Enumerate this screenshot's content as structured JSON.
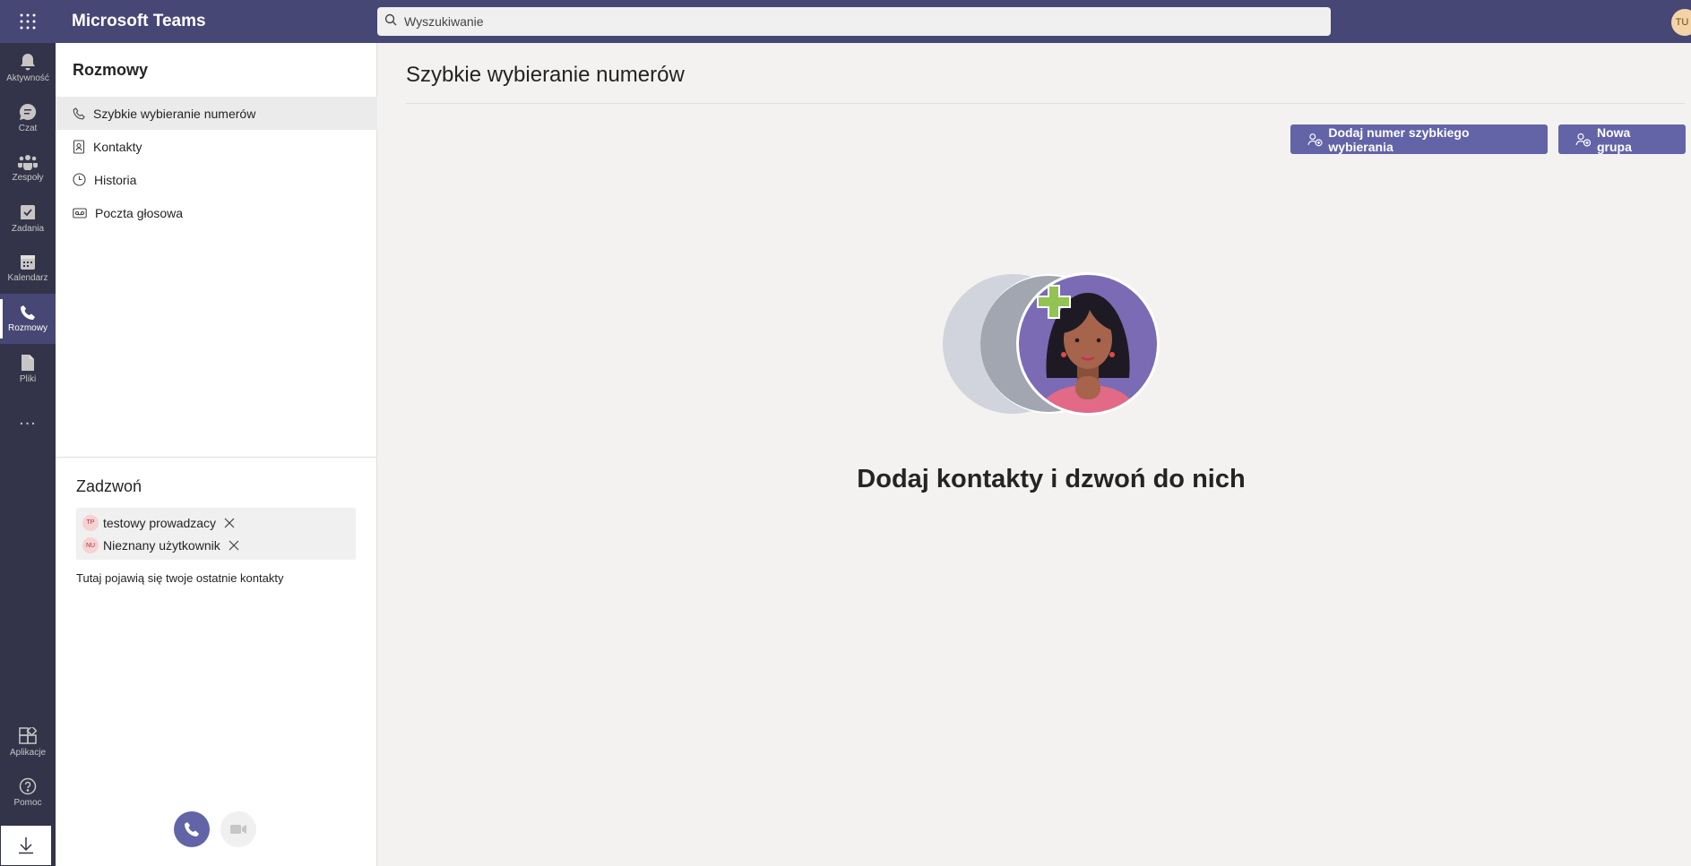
{
  "app": {
    "title": "Microsoft Teams",
    "user_initials": "TU"
  },
  "search": {
    "placeholder": "Wyszukiwanie"
  },
  "rail": {
    "items": [
      {
        "label": "Aktywność",
        "icon": "bell-icon"
      },
      {
        "label": "Czat",
        "icon": "chat-icon"
      },
      {
        "label": "Zespoły",
        "icon": "teams-icon"
      },
      {
        "label": "Zadania",
        "icon": "tasks-icon"
      },
      {
        "label": "Kalendarz",
        "icon": "calendar-icon"
      },
      {
        "label": "Rozmowy",
        "icon": "phone-icon",
        "active": true
      },
      {
        "label": "Pliki",
        "icon": "file-icon"
      },
      {
        "label": "...",
        "icon": "more-icon"
      }
    ],
    "bottom": [
      {
        "label": "Aplikacje",
        "icon": "apps-icon"
      },
      {
        "label": "Pomoc",
        "icon": "help-icon"
      }
    ]
  },
  "leftpane": {
    "title": "Rozmowy",
    "nav": [
      {
        "label": "Szybkie wybieranie numerów",
        "icon": "phone-icon",
        "active": true
      },
      {
        "label": "Kontakty",
        "icon": "contacts-icon"
      },
      {
        "label": "Historia",
        "icon": "clock-icon"
      },
      {
        "label": "Poczta głosowa",
        "icon": "voicemail-icon"
      }
    ],
    "call": {
      "title": "Zadzwoń",
      "chips": [
        {
          "initials": "TP",
          "name": "testowy prowadzacy"
        },
        {
          "initials": "NU",
          "name": "Nieznany użytkownik"
        }
      ],
      "recent_hint": "Tutaj pojawią się twoje ostatnie kontakty"
    }
  },
  "main": {
    "title": "Szybkie wybieranie numerów",
    "add_button": "Dodaj numer szybkiego wybierania",
    "group_button": "Nowa grupa",
    "empty_title": "Dodaj kontakty i dzwoń do nich"
  },
  "colors": {
    "brand": "#464775",
    "accent": "#6264a7",
    "rail": "#33344a"
  }
}
